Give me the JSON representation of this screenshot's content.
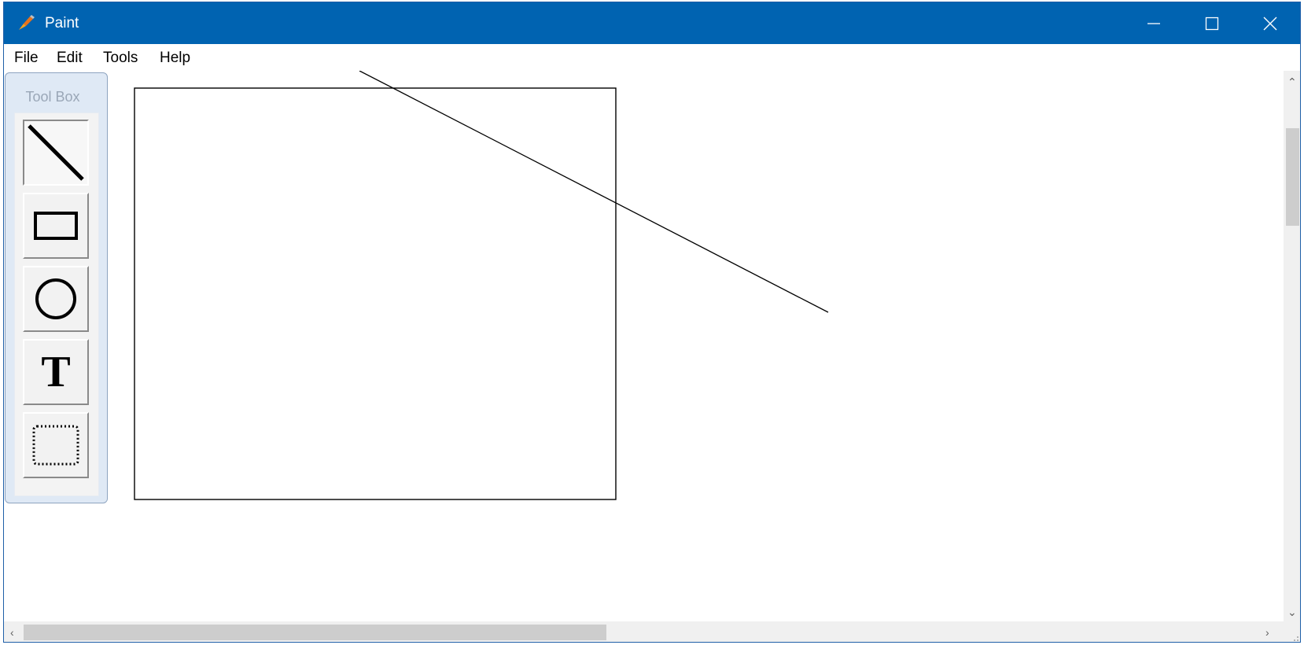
{
  "window": {
    "title": "Paint",
    "title_bar_color": "#0063b1"
  },
  "title_buttons": {
    "minimize_icon": "minimize-icon",
    "maximize_icon": "maximize-icon",
    "close_icon": "close-icon"
  },
  "menu": {
    "items": [
      "File",
      "Edit",
      "Tools",
      "Help"
    ]
  },
  "toolbox": {
    "title": "Tool Box",
    "tools": [
      {
        "name": "line",
        "icon": "line-icon",
        "selected": true
      },
      {
        "name": "rectangle",
        "icon": "rectangle-icon",
        "selected": false
      },
      {
        "name": "ellipse",
        "icon": "ellipse-icon",
        "selected": false
      },
      {
        "name": "text",
        "icon": "text-icon",
        "glyph": "T",
        "selected": false
      },
      {
        "name": "select",
        "icon": "selection-icon",
        "selected": false
      }
    ]
  },
  "canvas": {
    "shapes": [
      "rectangle",
      "line"
    ]
  }
}
